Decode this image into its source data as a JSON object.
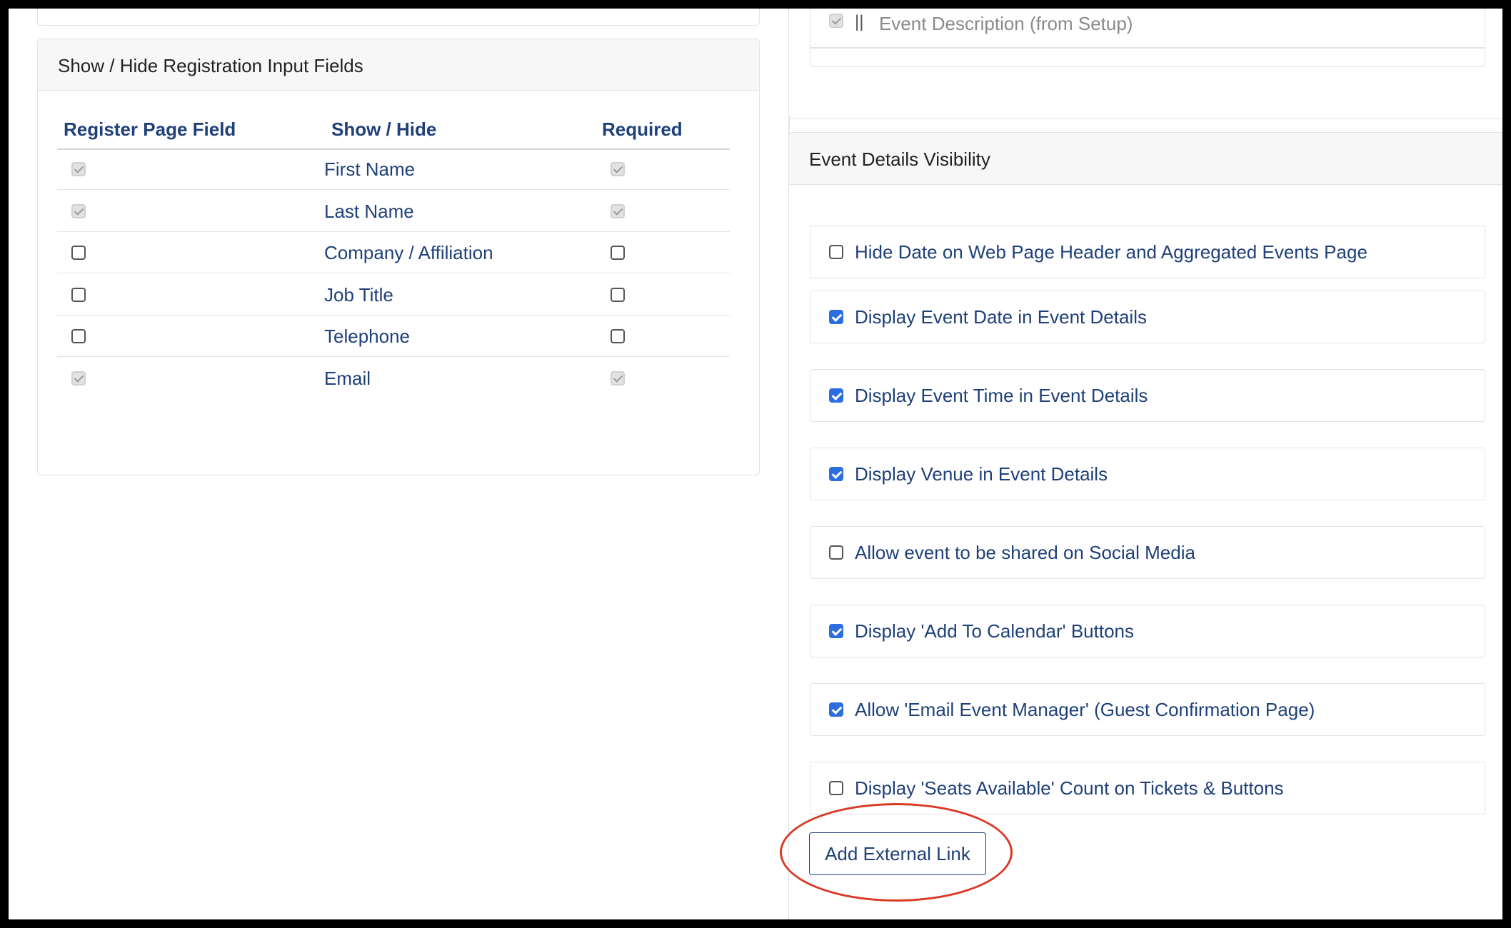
{
  "left_panel": {
    "title": "Show / Hide Registration Input Fields",
    "columns": [
      "Register Page Field",
      "Show / Hide",
      "Required"
    ],
    "rows": [
      {
        "label": "First Name",
        "show": "checked-disabled",
        "required": "checked-disabled"
      },
      {
        "label": "Last Name",
        "show": "checked-disabled",
        "required": "checked-disabled"
      },
      {
        "label": "Company / Affiliation",
        "show": "unchecked",
        "required": "unchecked"
      },
      {
        "label": "Job Title",
        "show": "unchecked",
        "required": "unchecked"
      },
      {
        "label": "Telephone",
        "show": "unchecked",
        "required": "unchecked"
      },
      {
        "label": "Email",
        "show": "checked-disabled",
        "required": "checked-disabled"
      }
    ]
  },
  "top_right": {
    "separator": "||",
    "label": "Event Description (from Setup)"
  },
  "event_details": {
    "title": "Event Details Visibility",
    "options": [
      {
        "label": "Hide Date on Web Page Header and Aggregated Events Page",
        "checked": false
      },
      {
        "label": "Display Event Date in Event Details",
        "checked": true
      },
      {
        "label": "Display Event Time in Event Details",
        "checked": true
      },
      {
        "label": "Display Venue in Event Details",
        "checked": true
      },
      {
        "label": "Allow event to be shared on Social Media",
        "checked": false
      },
      {
        "label": "Display 'Add To Calendar' Buttons",
        "checked": true
      },
      {
        "label": "Allow 'Email Event Manager' (Guest Confirmation Page)",
        "checked": true
      },
      {
        "label": "Display 'Seats Available' Count on Tickets & Buttons",
        "checked": false
      }
    ],
    "add_link_button": "Add External Link"
  },
  "colors": {
    "text_primary": "#1f4078",
    "checkbox_checked": "#2c6de0",
    "highlight": "#d93a26"
  }
}
